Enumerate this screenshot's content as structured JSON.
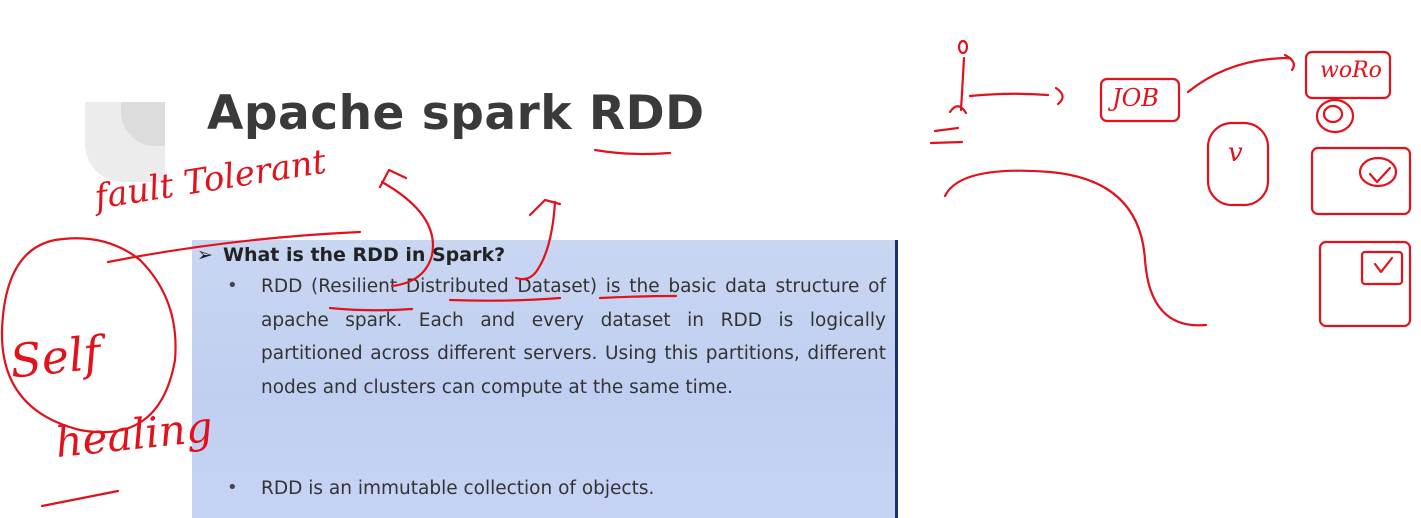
{
  "slide": {
    "title": "Apache spark RDD",
    "question": "What is the RDD in Spark?",
    "bullet_char": "•",
    "arrow_char": "➢",
    "bullets": [
      "RDD (Resilient Distributed Dataset) is the basic data structure of apache spark. Each and every dataset in RDD is logically partitioned across different servers. Using this partitions, different nodes and clusters can compute at the same time.",
      "RDD is an immutable collection of objects."
    ]
  },
  "annotations": {
    "fault_tolerant": "fault Tolerant",
    "self": "Self",
    "healing": "healing",
    "job": "JOB",
    "worker": "woRo",
    "v": "v"
  },
  "colors": {
    "ink": "#e1121b",
    "box": "#c3d1f2",
    "title": "#3a3a3a"
  }
}
